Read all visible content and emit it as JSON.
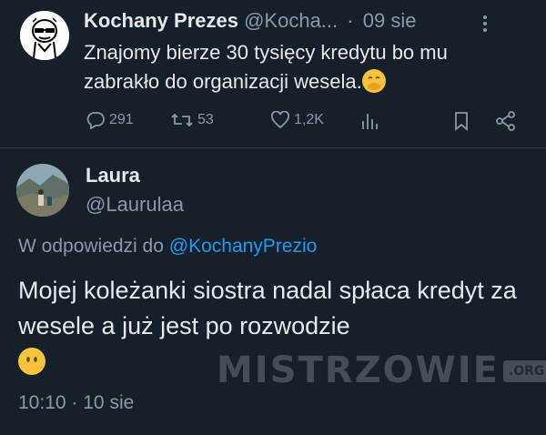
{
  "tweet": {
    "author_name": "Kochany Prezes",
    "author_handle": "@Kocha...",
    "separator": "·",
    "date": "09 sie",
    "text": "Znajomy bierze 30 tysięcy kredytu bo mu zabrakło do organizacji wesela.",
    "emoji": "face-with-hand-over-mouth-emoji",
    "more_icon": "more-icon",
    "stats": {
      "replies": "291",
      "retweets": "53",
      "likes": "1,2K"
    },
    "icons": [
      "reply-icon",
      "retweet-icon",
      "like-icon",
      "views-icon",
      "bookmark-icon",
      "share-icon"
    ]
  },
  "reply_tweet": {
    "author_name": "Laura",
    "author_handle": "@Laurulaa",
    "replying_prefix": "W odpowiedzi do",
    "replying_to": "@KochanyPrezio",
    "text": "Mojej koleżanki siostra nadal spłaca kredyt za wesele a już jest po rozwodzie",
    "emoji": "face-without-mouth-emoji",
    "time": "10:10",
    "separator": "·",
    "date": "10 sie"
  },
  "watermark": {
    "text": "MISTRZOWIE",
    "suffix": ".ORG"
  },
  "colors": {
    "background": "#15202b",
    "text": "#e7e9ea",
    "muted": "#8b98a5",
    "link": "#1d9bf0",
    "emoji": "#f7c33c"
  }
}
